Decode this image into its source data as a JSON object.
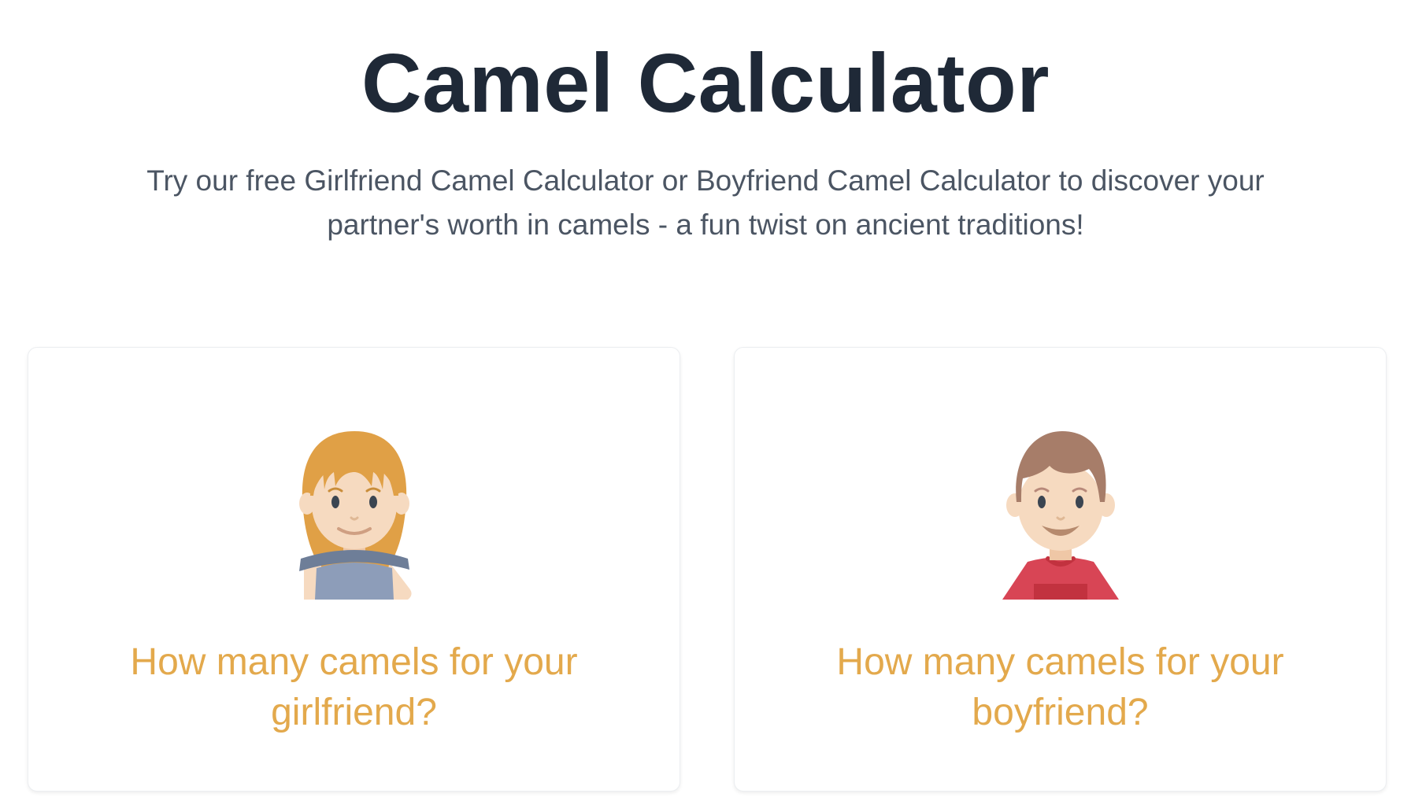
{
  "header": {
    "title": "Camel Calculator",
    "subtitle": "Try our free Girlfriend Camel Calculator or Boyfriend Camel Calculator to discover your partner's worth in camels - a fun twist on ancient traditions!"
  },
  "cards": [
    {
      "id": "girlfriend",
      "label": "How many camels for your girlfriend?",
      "icon": "girl-avatar-icon"
    },
    {
      "id": "boyfriend",
      "label": "How many camels for your boyfriend?",
      "icon": "boy-avatar-icon"
    }
  ],
  "colors": {
    "title": "#1f2937",
    "subtitle": "#4b5563",
    "card_label": "#e3a94c",
    "card_border": "#eceef1",
    "girl_hair": "#e0a046",
    "girl_top": "#8d9db9",
    "girl_top_trim": "#6e7e98",
    "boy_hair": "#a77d69",
    "boy_shirt": "#d84555",
    "boy_shirt_dark": "#c2323f",
    "skin": "#f6dac0"
  }
}
